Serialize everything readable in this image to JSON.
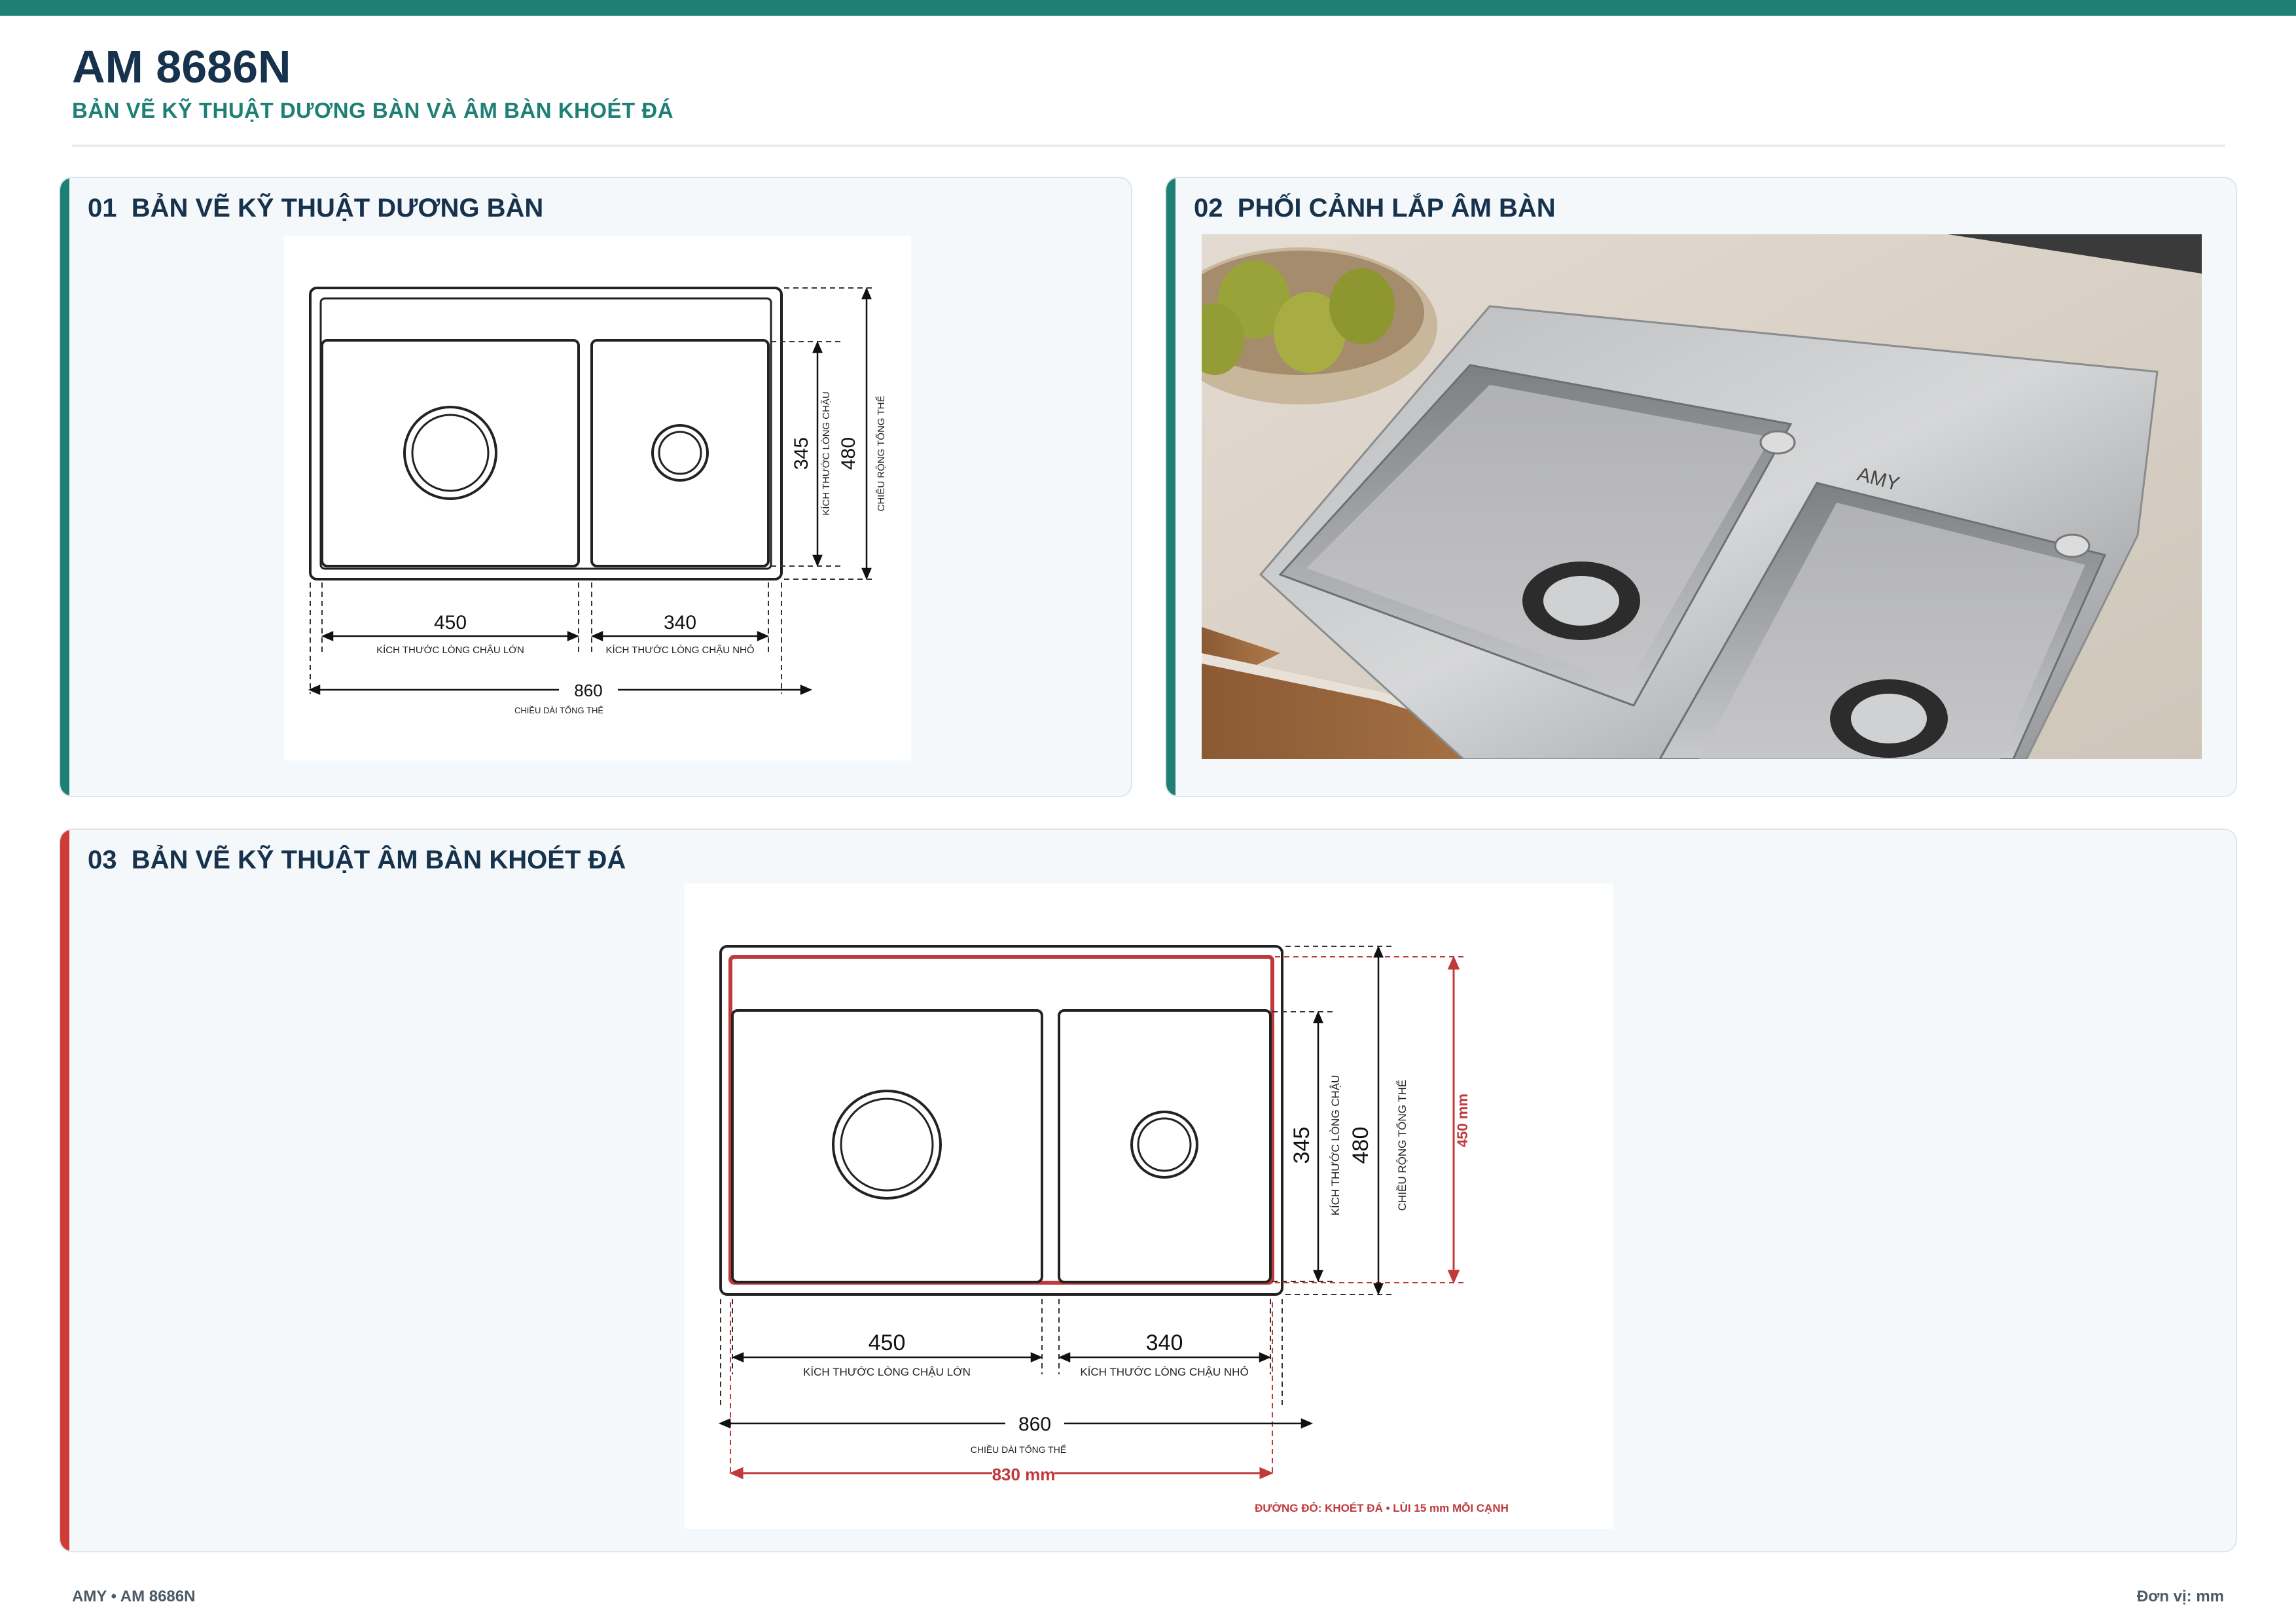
{
  "header": {
    "model": "AM 8686N",
    "subtitle": "BẢN VẼ KỸ THUẬT DƯƠNG BÀN VÀ ÂM BÀN KHOÉT ĐÁ"
  },
  "panels": [
    {
      "number": "01",
      "title": "BẢN VẼ KỸ THUẬT DƯƠNG BÀN"
    },
    {
      "number": "02",
      "title": "PHỐI CẢNH LẮP ÂM BÀN"
    },
    {
      "number": "03",
      "title": "BẢN VẼ KỸ THUẬT ÂM BÀN KHOÉT ĐÁ"
    }
  ],
  "drawing_topmount": {
    "bowl_large_width": "450",
    "bowl_large_label": "KÍCH THƯỚC LÒNG CHẬU LỚN",
    "bowl_small_width": "340",
    "bowl_small_label": "KÍCH THƯỚC LÒNG CHẬU NHỎ",
    "overall_length": "860",
    "overall_length_label": "CHIỀU DÀI TỔNG THỂ",
    "bowl_depth": "345",
    "bowl_depth_label": "KÍCH THƯỚC LÒNG CHẬU",
    "overall_width": "480",
    "overall_width_label": "CHIỀU RỘNG TỔNG THỂ"
  },
  "drawing_undermount": {
    "bowl_large_width": "450",
    "bowl_large_label": "KÍCH THƯỚC LÒNG CHẬU LỚN",
    "bowl_small_width": "340",
    "bowl_small_label": "KÍCH THƯỚC LÒNG CHẬU NHỎ",
    "overall_length": "860",
    "overall_length_label": "CHIỀU DÀI TỔNG THỂ",
    "bowl_depth": "345",
    "bowl_depth_label": "KÍCH THƯỚC LÒNG CHẬU",
    "overall_width": "480",
    "overall_width_label": "CHIỀU RỘNG TỔNG THỂ",
    "cutout_width": "450 mm",
    "cutout_length": "830 mm",
    "cutout_note": "ĐƯỜNG ĐỎ: KHOÉT ĐÁ • LÙI 15 mm MỖI CẠNH"
  },
  "photo": {
    "brand": "AMY"
  },
  "footer": {
    "left": "AMY • AM 8686N",
    "right": "Đơn vị: mm"
  },
  "colors": {
    "accent_teal": "#1e7f74",
    "accent_red": "#cf3b36",
    "cutout_red": "#c0393b",
    "title_navy": "#16324d"
  }
}
